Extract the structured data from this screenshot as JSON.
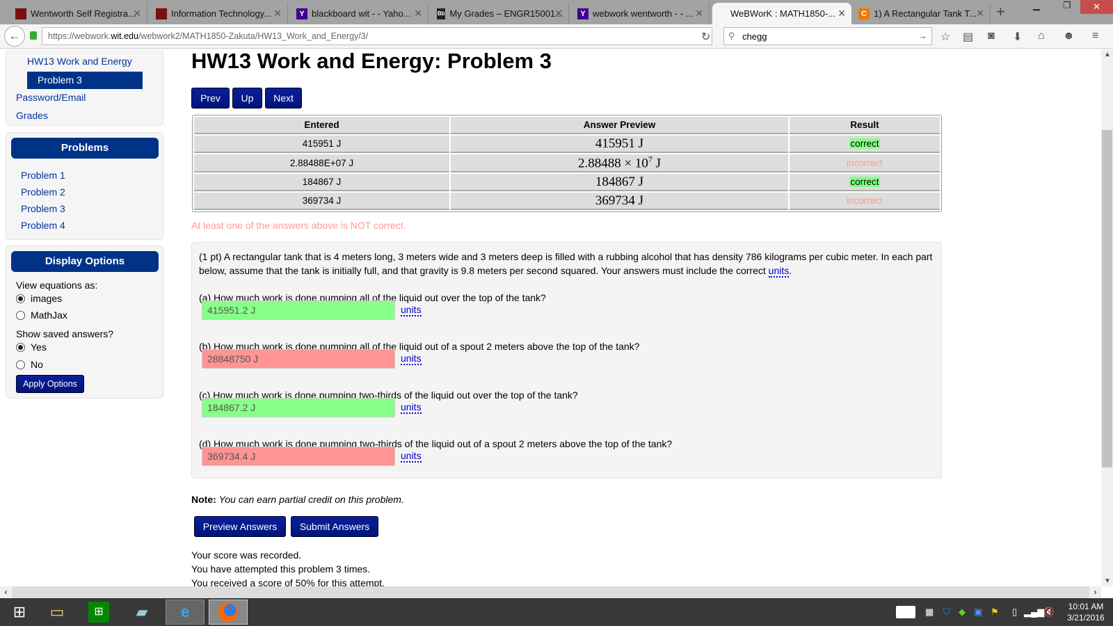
{
  "browser": {
    "tabs": [
      {
        "title": "Wentworth Self Registra...",
        "icon": "wentworth-icon",
        "color": "#7a1010"
      },
      {
        "title": "Information Technology...",
        "icon": "wentworth-icon",
        "color": "#7a1010"
      },
      {
        "title": "blackboard wit - - Yaho...",
        "icon": "yahoo-icon",
        "color": "#400090"
      },
      {
        "title": "My Grades – ENGR15001...",
        "icon": "blackboard-icon",
        "color": "#222"
      },
      {
        "title": "webwork wentworth - - ...",
        "icon": "yahoo-icon",
        "color": "#400090"
      },
      {
        "title": "WeBWorK : MATH1850-...",
        "icon": "",
        "color": "",
        "active": true
      },
      {
        "title": "1) A Rectangular Tank T...",
        "icon": "chegg-icon",
        "color": "#f07800"
      }
    ],
    "url_host_prefix": "https://webwork.",
    "url_host": "wit.edu",
    "url_path": "/webwork2/MATH1850-Zakuta/HW13_Work_and_Energy/3/",
    "search_value": "chegg"
  },
  "sidebar": {
    "set_link": "HW13 Work and Energy",
    "current_problem": "Problem 3",
    "password_link": "Password/Email",
    "grades_link": "Grades",
    "problems_title": "Problems",
    "problems": [
      "Problem 1",
      "Problem 2",
      "Problem 3",
      "Problem 4"
    ],
    "display_title": "Display Options",
    "view_label": "View equations as:",
    "view_options": [
      "images",
      "MathJax"
    ],
    "view_selected": "images",
    "saved_label": "Show saved answers?",
    "saved_options": [
      "Yes",
      "No"
    ],
    "saved_selected": "Yes",
    "apply_label": "Apply Options"
  },
  "main": {
    "title": "HW13 Work and Energy: Problem 3",
    "nav": {
      "prev": "Prev",
      "up": "Up",
      "next": "Next"
    },
    "results_headers": [
      "Entered",
      "Answer Preview",
      "Result"
    ],
    "results": [
      {
        "entered": "415951 J",
        "preview": "415951 J",
        "result": "correct"
      },
      {
        "entered": "2.88488E+07 J",
        "preview_base": "2.88488 × 10",
        "preview_exp": "7",
        "preview_unit": " J",
        "result": "incorrect"
      },
      {
        "entered": "184867 J",
        "preview": "184867 J",
        "result": "correct"
      },
      {
        "entered": "369734 J",
        "preview": "369734 J",
        "result": "incorrect"
      }
    ],
    "warning": "At least one of the answers above is NOT correct.",
    "problem_text_1": "(1 pt) A rectangular tank that is 4 meters long, 3 meters wide and 3 meters deep is filled with a rubbing alcohol that has density 786 kilograms per cubic meter. In each part below, assume that the tank is initially full, and that gravity is 9.8 meters per second squared. Your answers must include the correct ",
    "units_link": "units",
    "problem_text_end": ".",
    "parts": [
      {
        "question": "(a) How much work is done pumping all of the liquid out over the top of the tank?",
        "answer": "415951.2 J",
        "status": "correct"
      },
      {
        "question": "(b) How much work is done pumping all of the liquid out of a spout 2 meters above the top of the tank?",
        "answer": "28848750 J",
        "status": "incorrect"
      },
      {
        "question": "(c) How much work is done pumping two-thirds of the liquid out over the top of the tank?",
        "answer": "184867.2 J",
        "status": "correct"
      },
      {
        "question": "(d) How much work is done pumping two-thirds of the liquid out of a spout 2 meters above the top of the tank?",
        "answer": "369734.4 J",
        "status": "incorrect"
      }
    ],
    "note_label": "Note:",
    "note_text": "You can earn partial credit on this problem.",
    "preview_button": "Preview Answers",
    "submit_button": "Submit Answers",
    "score_lines": [
      "Your score was recorded.",
      "You have attempted this problem 3 times.",
      "You received a score of 50% for this attempt."
    ]
  },
  "taskbar": {
    "time": "10:01 AM",
    "date": "3/21/2016"
  },
  "colors": {
    "brand": "#003388",
    "correct": "#88ff88",
    "incorrect_field": "#ff9494",
    "warning": "#ff9999"
  }
}
